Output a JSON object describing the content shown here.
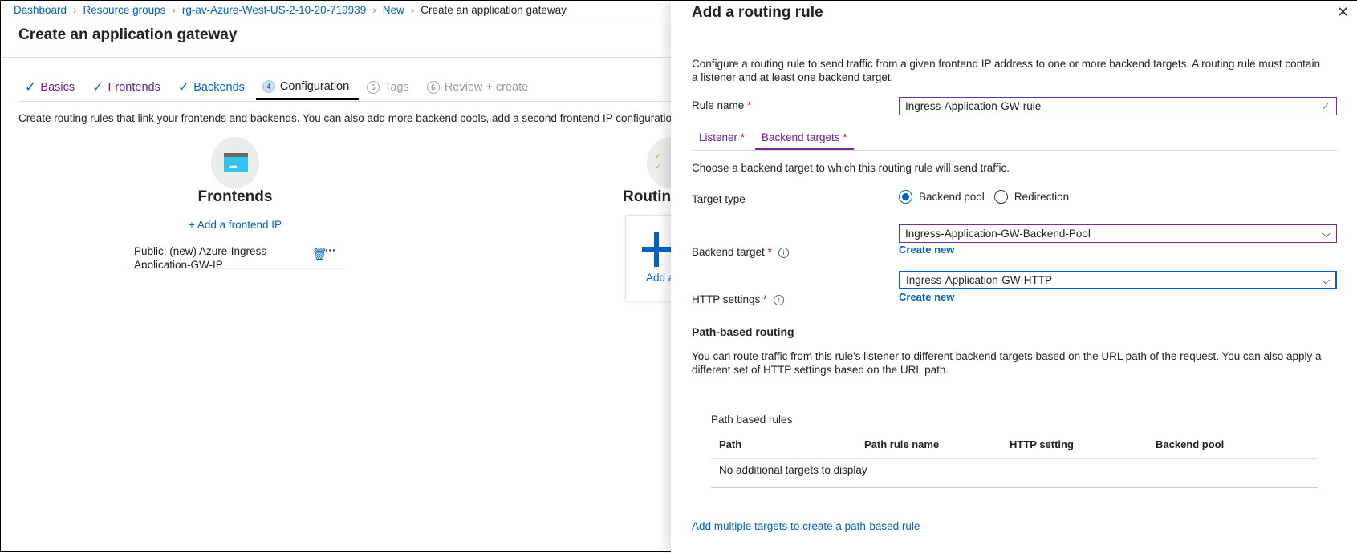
{
  "breadcrumb": [
    "Dashboard",
    "Resource groups",
    "rg-av-Azure-West-US-2-10-20-719939",
    "New",
    "Create an application gateway"
  ],
  "page_title": "Create an application gateway",
  "tabs": [
    {
      "label": "Basics",
      "state": "done"
    },
    {
      "label": "Frontends",
      "state": "done"
    },
    {
      "label": "Backends",
      "state": "done"
    },
    {
      "num": "4",
      "label": "Configuration",
      "state": "current"
    },
    {
      "num": "5",
      "label": "Tags",
      "state": "disabled"
    },
    {
      "num": "6",
      "label": "Review + create",
      "state": "disabled"
    }
  ],
  "description": "Create routing rules that link your frontends and backends. You can also add more backend pools, add a second frontend IP configuration if yo",
  "frontends": {
    "title": "Frontends",
    "add_label": "+ Add a frontend IP",
    "item": "Public: (new) Azure-Ingress-Application-GW-IP",
    "more": "···"
  },
  "routing": {
    "title": "Routin",
    "add_label": "Add a"
  },
  "panel": {
    "title": "Add a routing rule",
    "close": "✕",
    "description": "Configure a routing rule to send traffic from a given frontend IP address to one or more backend targets. A routing rule must contain a listener and at least one backend target.",
    "rule_name_label": "Rule name",
    "rule_name_value": "Ingress-Application-GW-rule",
    "req": "*",
    "tabs": {
      "listener": "Listener",
      "backend": "Backend targets"
    },
    "choose_text": "Choose a backend target to which this routing rule will send traffic.",
    "target_type_label": "Target type",
    "target_type_options": [
      "Backend pool",
      "Redirection"
    ],
    "target_type_selected": "Backend pool",
    "backend_target_label": "Backend target",
    "backend_target_value": "Ingress-Application-GW-Backend-Pool",
    "http_settings_label": "HTTP settings",
    "http_settings_value": "Ingress-Application-GW-HTTP",
    "create_new": "Create new",
    "path_heading": "Path-based routing",
    "path_text": "You can route traffic from this rule's listener to different backend targets based on the URL path of the request. You can also apply a different set of HTTP settings based on the URL path.",
    "path_rules_title": "Path based rules",
    "columns": [
      "Path",
      "Path rule name",
      "HTTP setting",
      "Backend pool"
    ],
    "empty_text": "No additional targets to display",
    "add_multiple": "Add multiple targets to create a path-based rule"
  },
  "colors": {
    "link": "#0062c4",
    "purple": "#7a2a9e",
    "valid": "#5ea836"
  }
}
